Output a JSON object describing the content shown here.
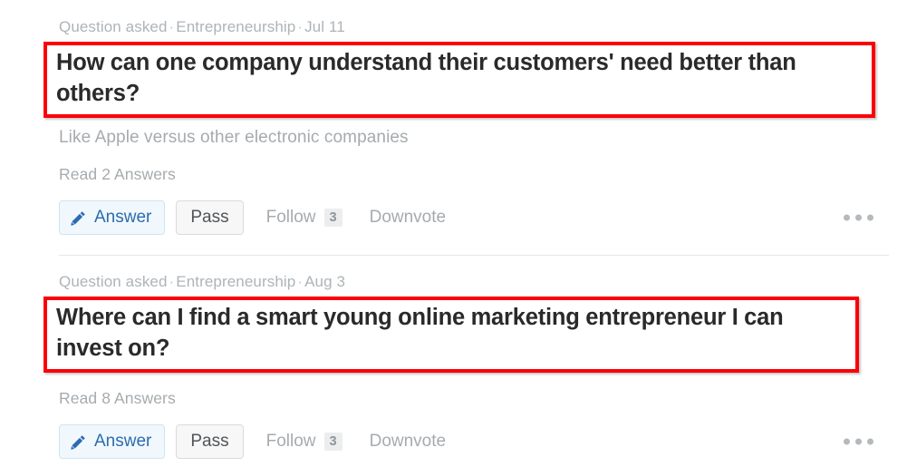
{
  "feed": {
    "stories": [
      {
        "meta": {
          "action": "Question asked",
          "topic": "Entrepreneurship",
          "date": "Jul 11",
          "separator": "·"
        },
        "title": "How can one company understand their customers' need better than others?",
        "description": "Like Apple versus other electronic companies",
        "read_answers": "Read 2 Answers",
        "actions": {
          "answer_label": "Answer",
          "answer_icon": "pencil-icon",
          "pass_label": "Pass",
          "follow_label": "Follow",
          "follow_count": "3",
          "downvote_label": "Downvote",
          "more_icon": "ellipsis-icon"
        },
        "highlight_color": "#fb0007"
      },
      {
        "meta": {
          "action": "Question asked",
          "topic": "Entrepreneurship",
          "date": "Aug 3",
          "separator": "·"
        },
        "title": "Where can I find a smart young online marketing entrepreneur I can invest on?",
        "description": "",
        "read_answers": "Read 8 Answers",
        "actions": {
          "answer_label": "Answer",
          "answer_icon": "pencil-icon",
          "pass_label": "Pass",
          "follow_label": "Follow",
          "follow_count": "3",
          "downvote_label": "Downvote",
          "more_icon": "ellipsis-icon"
        },
        "highlight_color": "#fb0007"
      }
    ],
    "colors": {
      "highlight": "#fb0007",
      "title_text": "#2a2a2a",
      "muted_text": "#a6abaf",
      "answer_blue": "#2b6cad",
      "answer_bg": "#f1f8fd",
      "pass_bg": "#f7f7f7",
      "badge_bg": "#eceded",
      "divider": "#e6e7e8"
    }
  }
}
